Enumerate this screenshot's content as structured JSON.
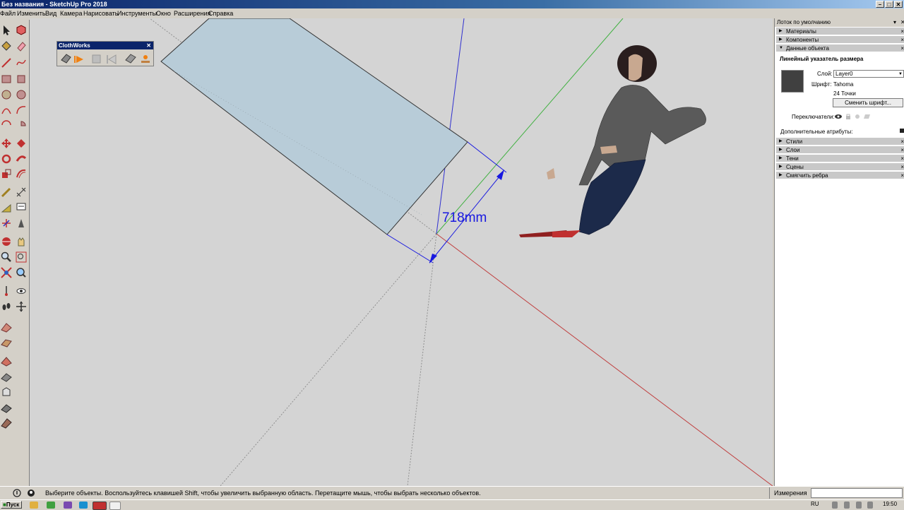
{
  "window": {
    "title": "Без названия - SketchUp Pro 2018",
    "minimize": "–",
    "maximize": "□",
    "close": "✕"
  },
  "menu": [
    "Файл",
    "Изменить",
    "Вид",
    "Камера",
    "Нарисовать",
    "Инструменты",
    "Окно",
    "Расширения",
    "Справка"
  ],
  "clothworks": {
    "title": "ClothWorks",
    "close": "✕"
  },
  "viewport": {
    "dimension_label": "718mm",
    "colors": {
      "red_axis": "#c04040",
      "green_axis": "#40b040",
      "blue_axis": "#3030d0",
      "dimension": "#1818e0",
      "face": "#b8ccd8"
    }
  },
  "tray": {
    "title": "Лоток по умолчанию",
    "sections_top": [
      {
        "arrow": "▶",
        "label": "Материалы"
      },
      {
        "arrow": "▶",
        "label": "Компоненты"
      },
      {
        "arrow": "▼",
        "label": "Данные объекта"
      }
    ],
    "entity": {
      "heading": "Линейный указатель размера",
      "layer_label": "Слой:",
      "layer_value": "Layer0",
      "font_label": "Шрифт:",
      "font_value": "Tahoma",
      "size_value": "24 Точки",
      "change_font_button": "Сменить шрифт...",
      "toggles_label": "Переключатели:",
      "extra_label": "Дополнительные атрибуты:"
    },
    "sections_bottom": [
      {
        "arrow": "▶",
        "label": "Стили"
      },
      {
        "arrow": "▶",
        "label": "Слои"
      },
      {
        "arrow": "▶",
        "label": "Тени"
      },
      {
        "arrow": "▶",
        "label": "Сцены"
      },
      {
        "arrow": "▶",
        "label": "Смягчить ребра"
      }
    ]
  },
  "status": {
    "hint": "Выберите объекты. Воспользуйтесь клавишей Shift, чтобы увеличить выбранную область. Перетащите мышь, чтобы выбрать несколько объектов.",
    "measure_label": "Измерения"
  },
  "taskbar": {
    "start": "Пуск",
    "lang": "RU",
    "clock": "19:50"
  }
}
